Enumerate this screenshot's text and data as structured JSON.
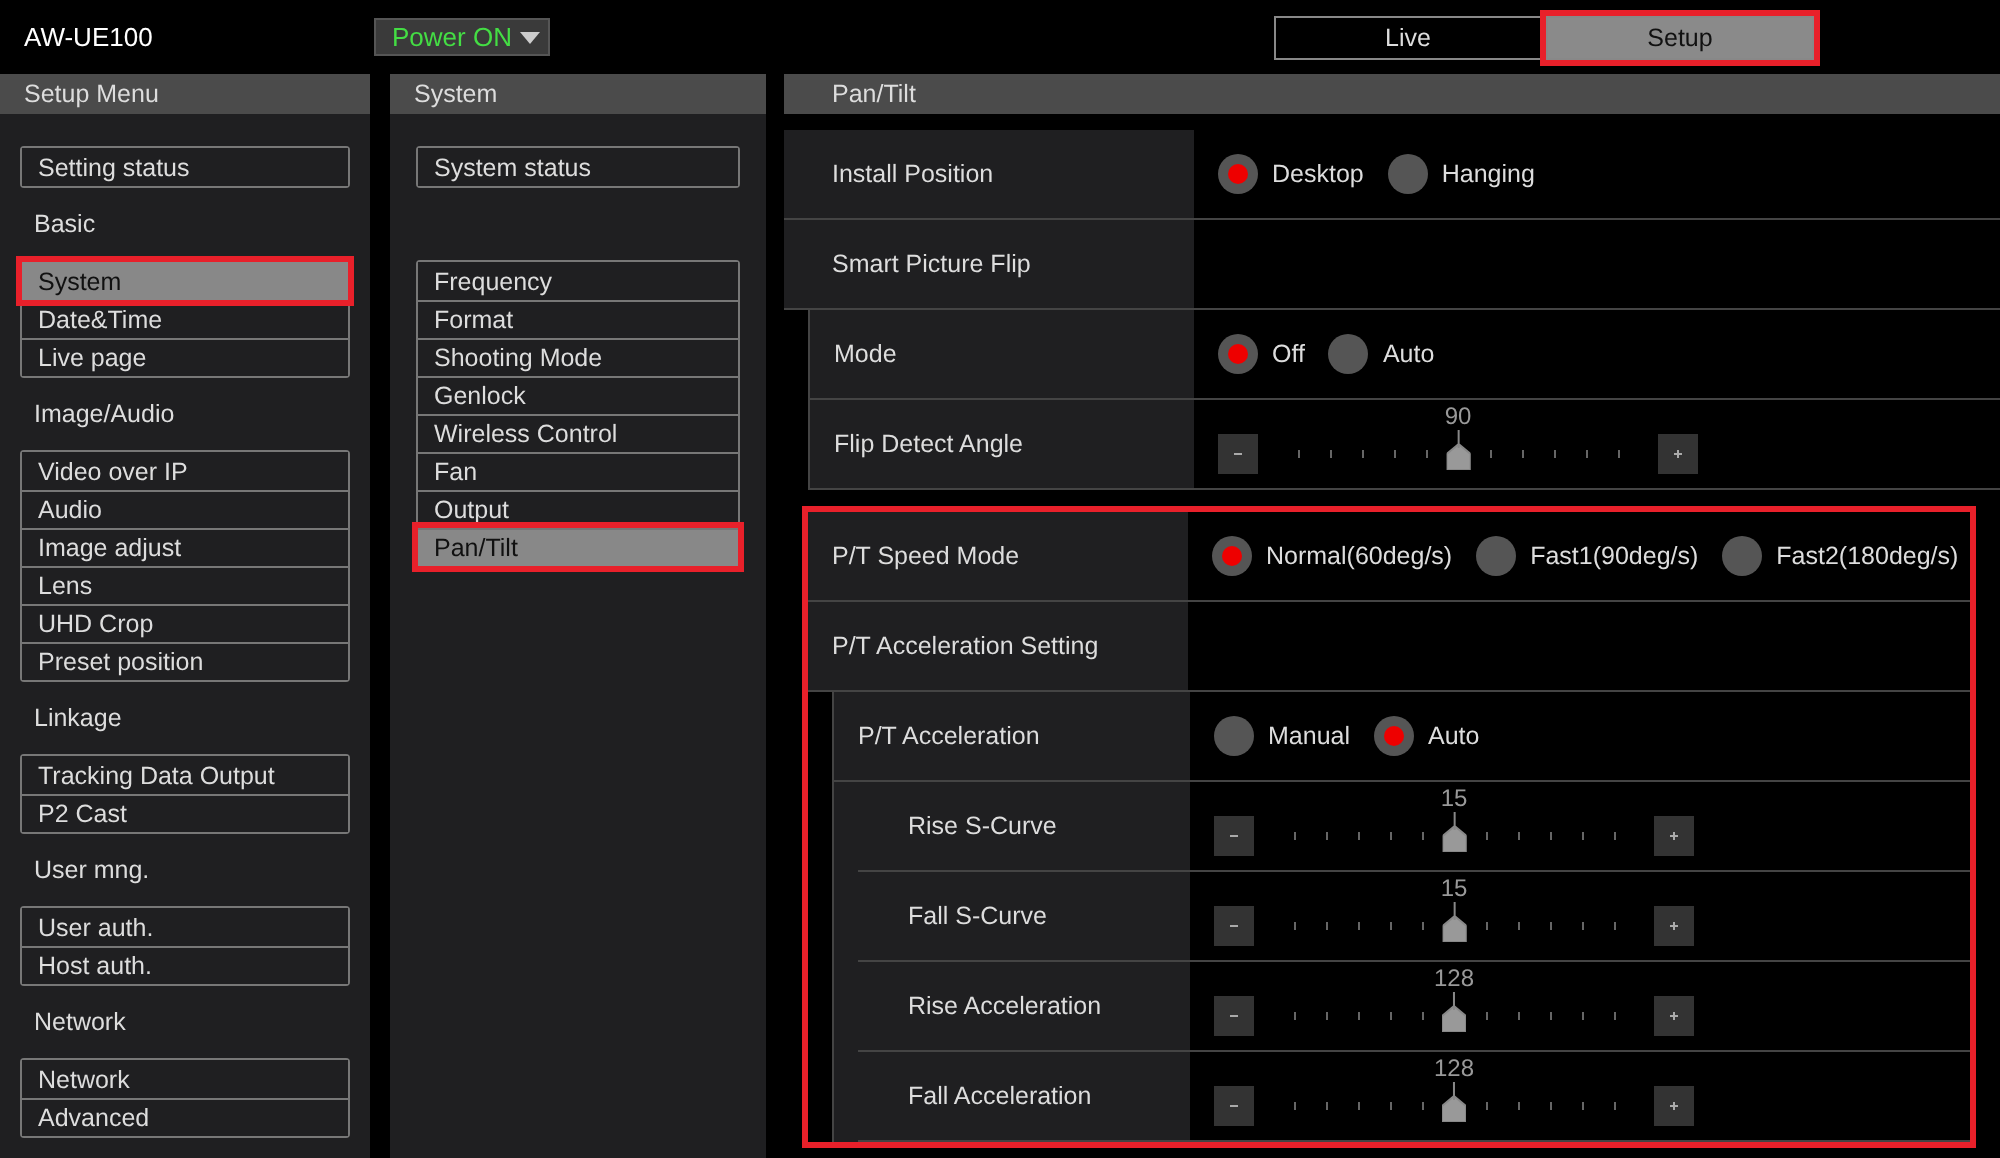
{
  "header": {
    "model": "AW-UE100",
    "power": "Power ON",
    "tabs": [
      {
        "label": "Live",
        "selected": false
      },
      {
        "label": "Setup",
        "selected": true
      }
    ]
  },
  "setup_menu": {
    "title": "Setup Menu",
    "groups": [
      {
        "items": [
          {
            "label": "Setting status",
            "selected": false
          }
        ]
      },
      {
        "heading": "Basic",
        "items": [
          {
            "label": "System",
            "selected": true
          },
          {
            "label": "Date&Time",
            "selected": false
          },
          {
            "label": "Live page",
            "selected": false
          }
        ]
      },
      {
        "heading": "Image/Audio",
        "items": [
          {
            "label": "Video over IP",
            "selected": false
          },
          {
            "label": "Audio",
            "selected": false
          },
          {
            "label": "Image adjust",
            "selected": false
          },
          {
            "label": "Lens",
            "selected": false
          },
          {
            "label": "UHD Crop",
            "selected": false
          },
          {
            "label": "Preset position",
            "selected": false
          }
        ]
      },
      {
        "heading": "Linkage",
        "items": [
          {
            "label": "Tracking Data Output",
            "selected": false
          },
          {
            "label": "P2 Cast",
            "selected": false
          }
        ]
      },
      {
        "heading": "User mng.",
        "items": [
          {
            "label": "User auth.",
            "selected": false
          },
          {
            "label": "Host auth.",
            "selected": false
          }
        ]
      },
      {
        "heading": "Network",
        "items": [
          {
            "label": "Network",
            "selected": false
          },
          {
            "label": "Advanced",
            "selected": false
          }
        ]
      }
    ]
  },
  "system_menu": {
    "title": "System",
    "groups": [
      {
        "items": [
          {
            "label": "System status",
            "selected": false
          }
        ]
      },
      {
        "items": [
          {
            "label": "Frequency",
            "selected": false
          },
          {
            "label": "Format",
            "selected": false
          },
          {
            "label": "Shooting Mode",
            "selected": false
          },
          {
            "label": "Genlock",
            "selected": false
          },
          {
            "label": "Wireless Control",
            "selected": false
          },
          {
            "label": "Fan",
            "selected": false
          },
          {
            "label": "Output",
            "selected": false
          },
          {
            "label": "Pan/Tilt",
            "selected": true
          }
        ]
      }
    ]
  },
  "settings": {
    "title": "Pan/Tilt",
    "sections": [
      {
        "highlighted": false,
        "rows": [
          {
            "kind": "radio",
            "label": "Install Position",
            "options": [
              {
                "label": "Desktop",
                "selected": true
              },
              {
                "label": "Hanging",
                "selected": false
              }
            ]
          },
          {
            "kind": "heading",
            "label": "Smart Picture Flip",
            "children": [
              {
                "kind": "radio",
                "label": "Mode",
                "options": [
                  {
                    "label": "Off",
                    "selected": true
                  },
                  {
                    "label": "Auto",
                    "selected": false
                  }
                ]
              },
              {
                "kind": "slider",
                "label": "Flip Detect Angle",
                "value": "90",
                "level": 0.5
              }
            ]
          }
        ]
      },
      {
        "highlighted": true,
        "rows": [
          {
            "kind": "radio",
            "label": "P/T Speed Mode",
            "options": [
              {
                "label": "Normal(60deg/s)",
                "selected": true
              },
              {
                "label": "Fast1(90deg/s)",
                "selected": false
              },
              {
                "label": "Fast2(180deg/s)",
                "selected": false
              }
            ]
          },
          {
            "kind": "heading",
            "label": "P/T Acceleration Setting",
            "children": [
              {
                "kind": "radio",
                "label": "P/T Acceleration",
                "options": [
                  {
                    "label": "Manual",
                    "selected": false
                  },
                  {
                    "label": "Auto",
                    "selected": true
                  }
                ],
                "children": [
                  {
                    "kind": "slider",
                    "label": "Rise S-Curve",
                    "value": "15",
                    "level": 0.5
                  },
                  {
                    "kind": "slider",
                    "label": "Fall S-Curve",
                    "value": "15",
                    "level": 0.5
                  },
                  {
                    "kind": "slider",
                    "label": "Rise Acceleration",
                    "value": "128",
                    "level": 0.5
                  },
                  {
                    "kind": "slider",
                    "label": "Fall Acceleration",
                    "value": "128",
                    "level": 0.5
                  }
                ]
              }
            ]
          }
        ]
      }
    ]
  }
}
